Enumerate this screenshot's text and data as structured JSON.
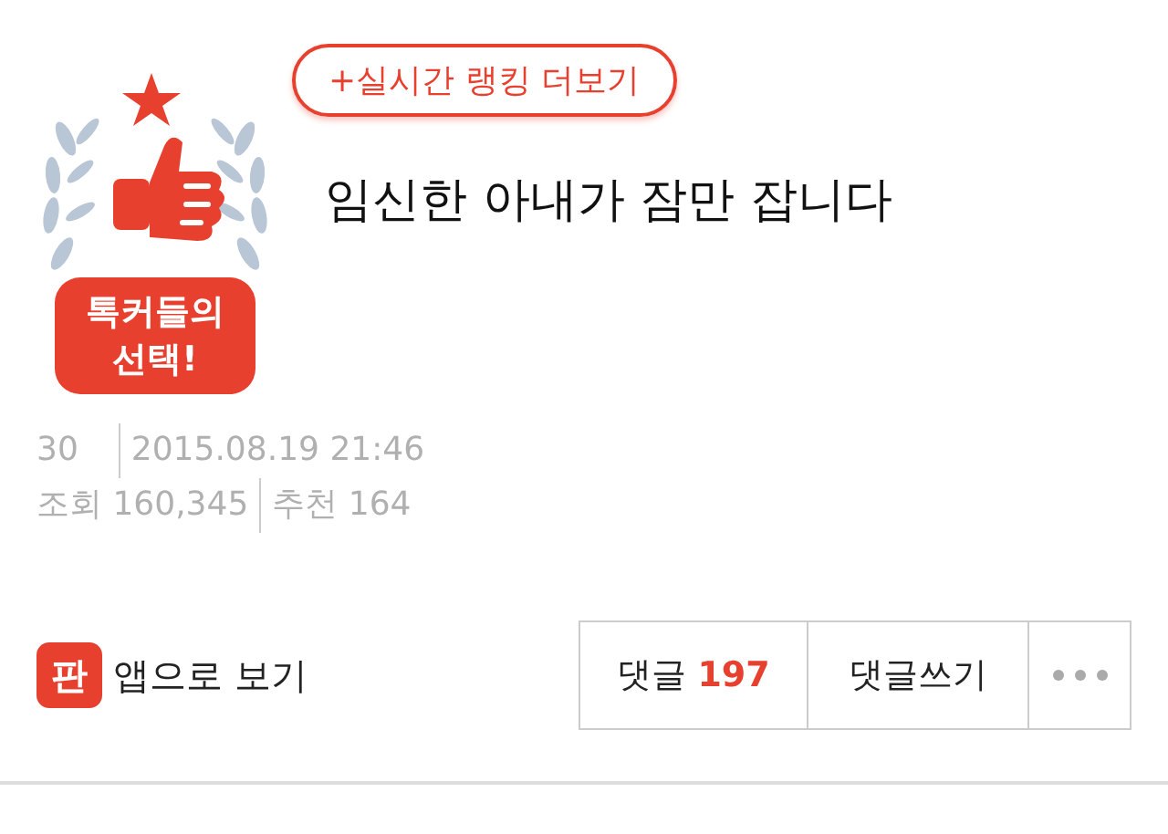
{
  "badge": {
    "label": "톡커들의 선택!"
  },
  "ranking_link": "+실시간 랭킹 더보기",
  "title": "임신한 아내가 잠만 잡니다",
  "meta": [
    [
      "30",
      "2015.08.19 21:46"
    ],
    [
      "조회 160,345",
      "추천 164"
    ]
  ],
  "app_link": {
    "icon_text": "판",
    "label": "앱으로 보기"
  },
  "actions": {
    "comments_label": "댓글",
    "comments_count": "197",
    "write_label": "댓글쓰기"
  }
}
